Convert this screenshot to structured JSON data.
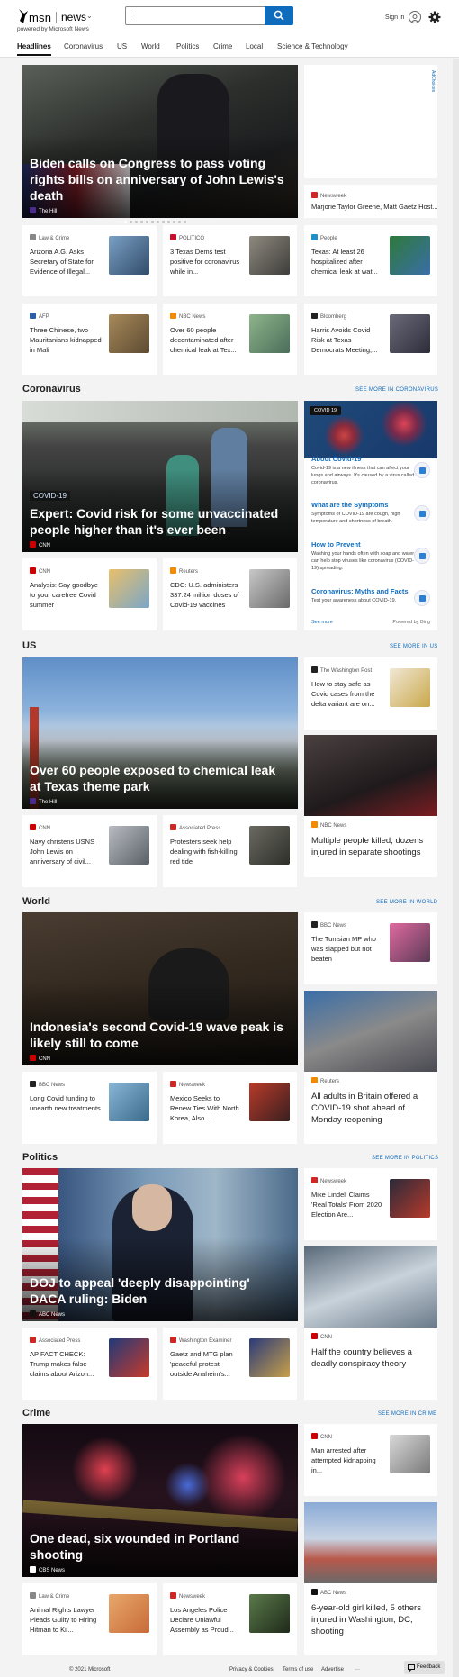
{
  "header": {
    "logo_text": "msn",
    "section": "news",
    "powered": "powered by Microsoft News",
    "search_placeholder": "",
    "sign_in": "Sign in"
  },
  "nav": [
    "Headlines",
    "Coronavirus",
    "US",
    "World",
    "Politics",
    "Crime",
    "Local",
    "Science & Technology"
  ],
  "ad_choices": "AdChoices",
  "top": {
    "hero": {
      "title": "Biden calls on Congress to pass voting rights bills on anniversary of John Lewis's death",
      "source": "The Hill"
    },
    "side": {
      "source": "Newsweek",
      "title": "Marjorie Taylor Greene, Matt Gaetz Host..."
    },
    "row1": [
      {
        "source": "Law & Crime",
        "title": "Arizona A.G. Asks Secretary of State for Evidence of Illegal..."
      },
      {
        "source": "POLITICO",
        "title": "3 Texas Dems test positive for coronavirus while in..."
      },
      {
        "source": "People",
        "title": "Texas: At least 26 hospitalized after chemical leak at wat..."
      }
    ],
    "row2": [
      {
        "source": "AFP",
        "title": "Three Chinese, two Mauritanians kidnapped in Mali"
      },
      {
        "source": "NBC News",
        "title": "Over 60 people decontaminated after chemical leak at Tex..."
      },
      {
        "source": "Bloomberg",
        "title": "Harris Avoids Covid Risk at Texas Democrats Meeting,..."
      }
    ]
  },
  "coronavirus": {
    "heading": "Coronavirus",
    "see_more": "SEE MORE IN CORONAVIRUS",
    "hero": {
      "tag": "COVID-19",
      "title": "Expert: Covid risk for some unvaccinated people higher than it's ever been",
      "source": "CNN"
    },
    "infocard": {
      "badge": "COVID 19",
      "items": [
        {
          "title": "About Covid-19",
          "desc": "Covid-19 is a new illness that can affect your lungs and airways. It's caused by a virus called coronavirus."
        },
        {
          "title": "What are the Symptoms",
          "desc": "Symptoms of COVID-19 are cough, high temperature and shortness of breath."
        },
        {
          "title": "How to Prevent",
          "desc": "Washing your hands often with soap and water can help stop viruses like coronavirus (COVID-19) spreading."
        },
        {
          "title": "Coronavirus: Myths and Facts",
          "desc": "Test your awareness about COVID-19."
        }
      ],
      "see_more": "See more",
      "powered": "Powered by Bing"
    },
    "row": [
      {
        "source": "CNN",
        "title": "Analysis: Say goodbye to your carefree Covid summer"
      },
      {
        "source": "Reuters",
        "title": "CDC: U.S. administers 337.24 million doses of Covid-19 vaccines"
      }
    ]
  },
  "us": {
    "heading": "US",
    "see_more": "SEE MORE IN US",
    "hero": {
      "title": "Over 60 people exposed to chemical leak at Texas theme park",
      "source": "The Hill"
    },
    "side": {
      "source": "The Washington Post",
      "title": "How to stay safe as Covid cases from the delta variant are on..."
    },
    "tall": {
      "source": "NBC News",
      "title": "Multiple people killed, dozens injured in separate shootings"
    },
    "row": [
      {
        "source": "CNN",
        "title": "Navy christens USNS John Lewis on anniversary of civil..."
      },
      {
        "source": "Associated Press",
        "title": "Protesters seek help dealing with fish-killing red tide"
      }
    ]
  },
  "world": {
    "heading": "World",
    "see_more": "SEE MORE IN WORLD",
    "hero": {
      "title": "Indonesia's second Covid-19 wave peak is likely still to come",
      "source": "CNN"
    },
    "side": {
      "source": "BBC News",
      "title": "The Tunisian MP who was slapped but not beaten"
    },
    "tall": {
      "source": "Reuters",
      "title": "All adults in Britain offered a COVID-19 shot ahead of Monday reopening"
    },
    "row": [
      {
        "source": "BBC News",
        "title": "Long Covid funding to unearth new treatments"
      },
      {
        "source": "Newsweek",
        "title": "Mexico Seeks to Renew Ties With North Korea, Also..."
      }
    ]
  },
  "politics": {
    "heading": "Politics",
    "see_more": "SEE MORE IN POLITICS",
    "hero": {
      "title": "DOJ to appeal 'deeply disappointing' DACA ruling: Biden",
      "source": "ABC News"
    },
    "side": {
      "source": "Newsweek",
      "title": "Mike Lindell Claims 'Real Totals' From 2020 Election Are..."
    },
    "tall": {
      "source": "CNN",
      "title": "Half the country believes a deadly conspiracy theory"
    },
    "row": [
      {
        "source": "Associated Press",
        "title": "AP FACT CHECK: Trump makes false claims about Arizon..."
      },
      {
        "source": "Washington Examiner",
        "title": "Gaetz and MTG plan 'peaceful protest' outside Anaheim's..."
      }
    ]
  },
  "crime": {
    "heading": "Crime",
    "see_more": "SEE MORE IN CRIME",
    "hero": {
      "title": "One dead, six wounded in Portland shooting",
      "source": "CBS News"
    },
    "side": {
      "source": "CNN",
      "title": "Man arrested after attempted kidnapping in..."
    },
    "tall": {
      "source": "ABC News",
      "title": "6-year-old girl killed, 5 others injured in Washington, DC, shooting"
    },
    "row": [
      {
        "source": "Law & Crime",
        "title": "Animal Rights Lawyer Pleads Guilty to Hiring Hitman to Kil..."
      },
      {
        "source": "Newsweek",
        "title": "Los Angeles Police Declare Unlawful Assembly as Proud..."
      }
    ]
  },
  "footer": {
    "copyright": "© 2021 Microsoft",
    "privacy": "Privacy & Cookies",
    "terms": "Terms of use",
    "advertise": "Advertise",
    "more": "···",
    "feedback": "Feedback"
  }
}
